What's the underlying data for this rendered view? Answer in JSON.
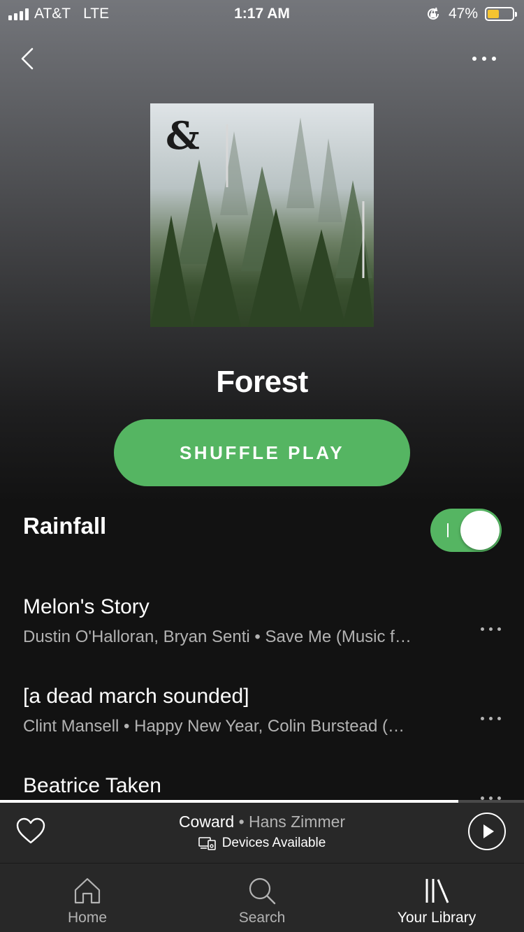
{
  "status_bar": {
    "carrier": "AT&T",
    "network": "LTE",
    "time": "1:17 AM",
    "battery_percent": "47%",
    "battery_level": 0.47,
    "battery_color": "#f5c431"
  },
  "header": {
    "back_icon": "chevron-left-icon",
    "more_icon": "more-horizontal-icon"
  },
  "playlist": {
    "title": "Forest",
    "cover_mark": "&"
  },
  "shuffle_button": {
    "label": "SHUFFLE PLAY",
    "color": "#55b562"
  },
  "section": {
    "title": "Rainfall",
    "toggle_on": true
  },
  "tracks": [
    {
      "title": "Melon's Story",
      "subtitle": "Dustin O'Halloran, Bryan Senti • Save Me (Music f…"
    },
    {
      "title": "[a dead march sounded]",
      "subtitle": "Clint Mansell • Happy New Year, Colin Burstead (…"
    },
    {
      "title": "Beatrice Taken",
      "subtitle": ""
    }
  ],
  "now_playing": {
    "song": "Coward",
    "separator": "•",
    "artist": "Hans Zimmer",
    "devices_label": "Devices Available",
    "progress": 0.875
  },
  "tab_bar": {
    "items": [
      {
        "label": "Home",
        "icon": "home-icon"
      },
      {
        "label": "Search",
        "icon": "search-icon"
      },
      {
        "label": "Your Library",
        "icon": "library-icon"
      }
    ]
  }
}
